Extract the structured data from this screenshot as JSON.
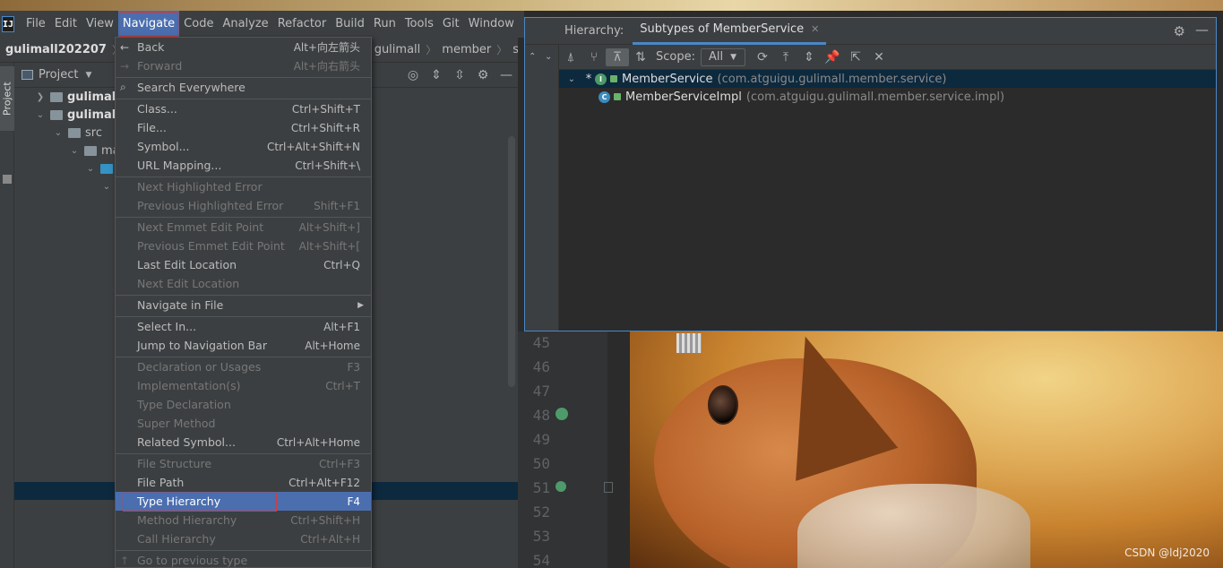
{
  "menubar": {
    "items": [
      "File",
      "Edit",
      "View",
      "Navigate",
      "Code",
      "Analyze",
      "Refactor",
      "Build",
      "Run",
      "Tools",
      "Git",
      "Window",
      "He"
    ]
  },
  "breadcrumbs": [
    "gulimall202207",
    "gu",
    "igu",
    "gulimall",
    "member",
    "s"
  ],
  "project_panel": {
    "title": "Project",
    "tab_label": "Project",
    "tree": [
      "gulimall",
      "gulimall",
      "src",
      "ma"
    ]
  },
  "navigate_menu": {
    "items": [
      {
        "label": "Back",
        "shortcut": "Alt+向左箭头",
        "disabled": false,
        "icon": "←"
      },
      {
        "label": "Forward",
        "shortcut": "Alt+向右箭头",
        "disabled": true,
        "icon": "→"
      },
      {
        "label": "Search Everywhere",
        "shortcut": "",
        "disabled": false,
        "icon": "⌕"
      },
      {
        "label": "Class...",
        "shortcut": "Ctrl+Shift+T",
        "disabled": false
      },
      {
        "label": "File...",
        "shortcut": "Ctrl+Shift+R",
        "disabled": false
      },
      {
        "label": "Symbol...",
        "shortcut": "Ctrl+Alt+Shift+N",
        "disabled": false
      },
      {
        "label": "URL Mapping...",
        "shortcut": "Ctrl+Shift+\\",
        "disabled": false
      },
      {
        "label": "Next Highlighted Error",
        "shortcut": "",
        "disabled": true
      },
      {
        "label": "Previous Highlighted Error",
        "shortcut": "Shift+F1",
        "disabled": true
      },
      {
        "label": "Next Emmet Edit Point",
        "shortcut": "Alt+Shift+]",
        "disabled": true
      },
      {
        "label": "Previous Emmet Edit Point",
        "shortcut": "Alt+Shift+[",
        "disabled": true
      },
      {
        "label": "Last Edit Location",
        "shortcut": "Ctrl+Q",
        "disabled": false
      },
      {
        "label": "Next Edit Location",
        "shortcut": "",
        "disabled": true
      },
      {
        "label": "Navigate in File",
        "shortcut": "",
        "disabled": false,
        "submenu": true
      },
      {
        "label": "Select In...",
        "shortcut": "Alt+F1",
        "disabled": false
      },
      {
        "label": "Jump to Navigation Bar",
        "shortcut": "Alt+Home",
        "disabled": false
      },
      {
        "label": "Declaration or Usages",
        "shortcut": "F3",
        "disabled": true
      },
      {
        "label": "Implementation(s)",
        "shortcut": "Ctrl+T",
        "disabled": true
      },
      {
        "label": "Type Declaration",
        "shortcut": "",
        "disabled": true
      },
      {
        "label": "Super Method",
        "shortcut": "",
        "disabled": true
      },
      {
        "label": "Related Symbol...",
        "shortcut": "Ctrl+Alt+Home",
        "disabled": false
      },
      {
        "label": "File Structure",
        "shortcut": "Ctrl+F3",
        "disabled": true
      },
      {
        "label": "File Path",
        "shortcut": "Ctrl+Alt+F12",
        "disabled": false
      },
      {
        "label": "Type Hierarchy",
        "shortcut": "F4",
        "disabled": false,
        "selected": true
      },
      {
        "label": "Method Hierarchy",
        "shortcut": "Ctrl+Shift+H",
        "disabled": true
      },
      {
        "label": "Call Hierarchy",
        "shortcut": "Ctrl+Alt+H",
        "disabled": true
      },
      {
        "label": "Go to previous type",
        "shortcut": "",
        "disabled": true,
        "icon": "↑"
      }
    ]
  },
  "hierarchy": {
    "label": "Hierarchy:",
    "tab": "Subtypes of MemberService",
    "scope_label": "Scope:",
    "scope_value": "All",
    "rows": [
      {
        "marker": "*",
        "badge": "I",
        "name": "MemberService",
        "pkg": "(com.atguigu.gulimall.member.service)"
      },
      {
        "marker": "",
        "badge": "C",
        "name": "MemberServiceImpl",
        "pkg": "(com.atguigu.gulimall.member.service.impl)"
      }
    ]
  },
  "editor": {
    "code_fragment": "imp",
    "line_numbers": [
      "45",
      "46",
      "47",
      "48",
      "49",
      "50",
      "51",
      "52",
      "53",
      "54"
    ]
  },
  "watermark": "CSDN @ldj2020",
  "colors": {
    "accent": "#4b6eaf",
    "highlight_box": "#d23c3c",
    "keyword": "#cc7832"
  }
}
